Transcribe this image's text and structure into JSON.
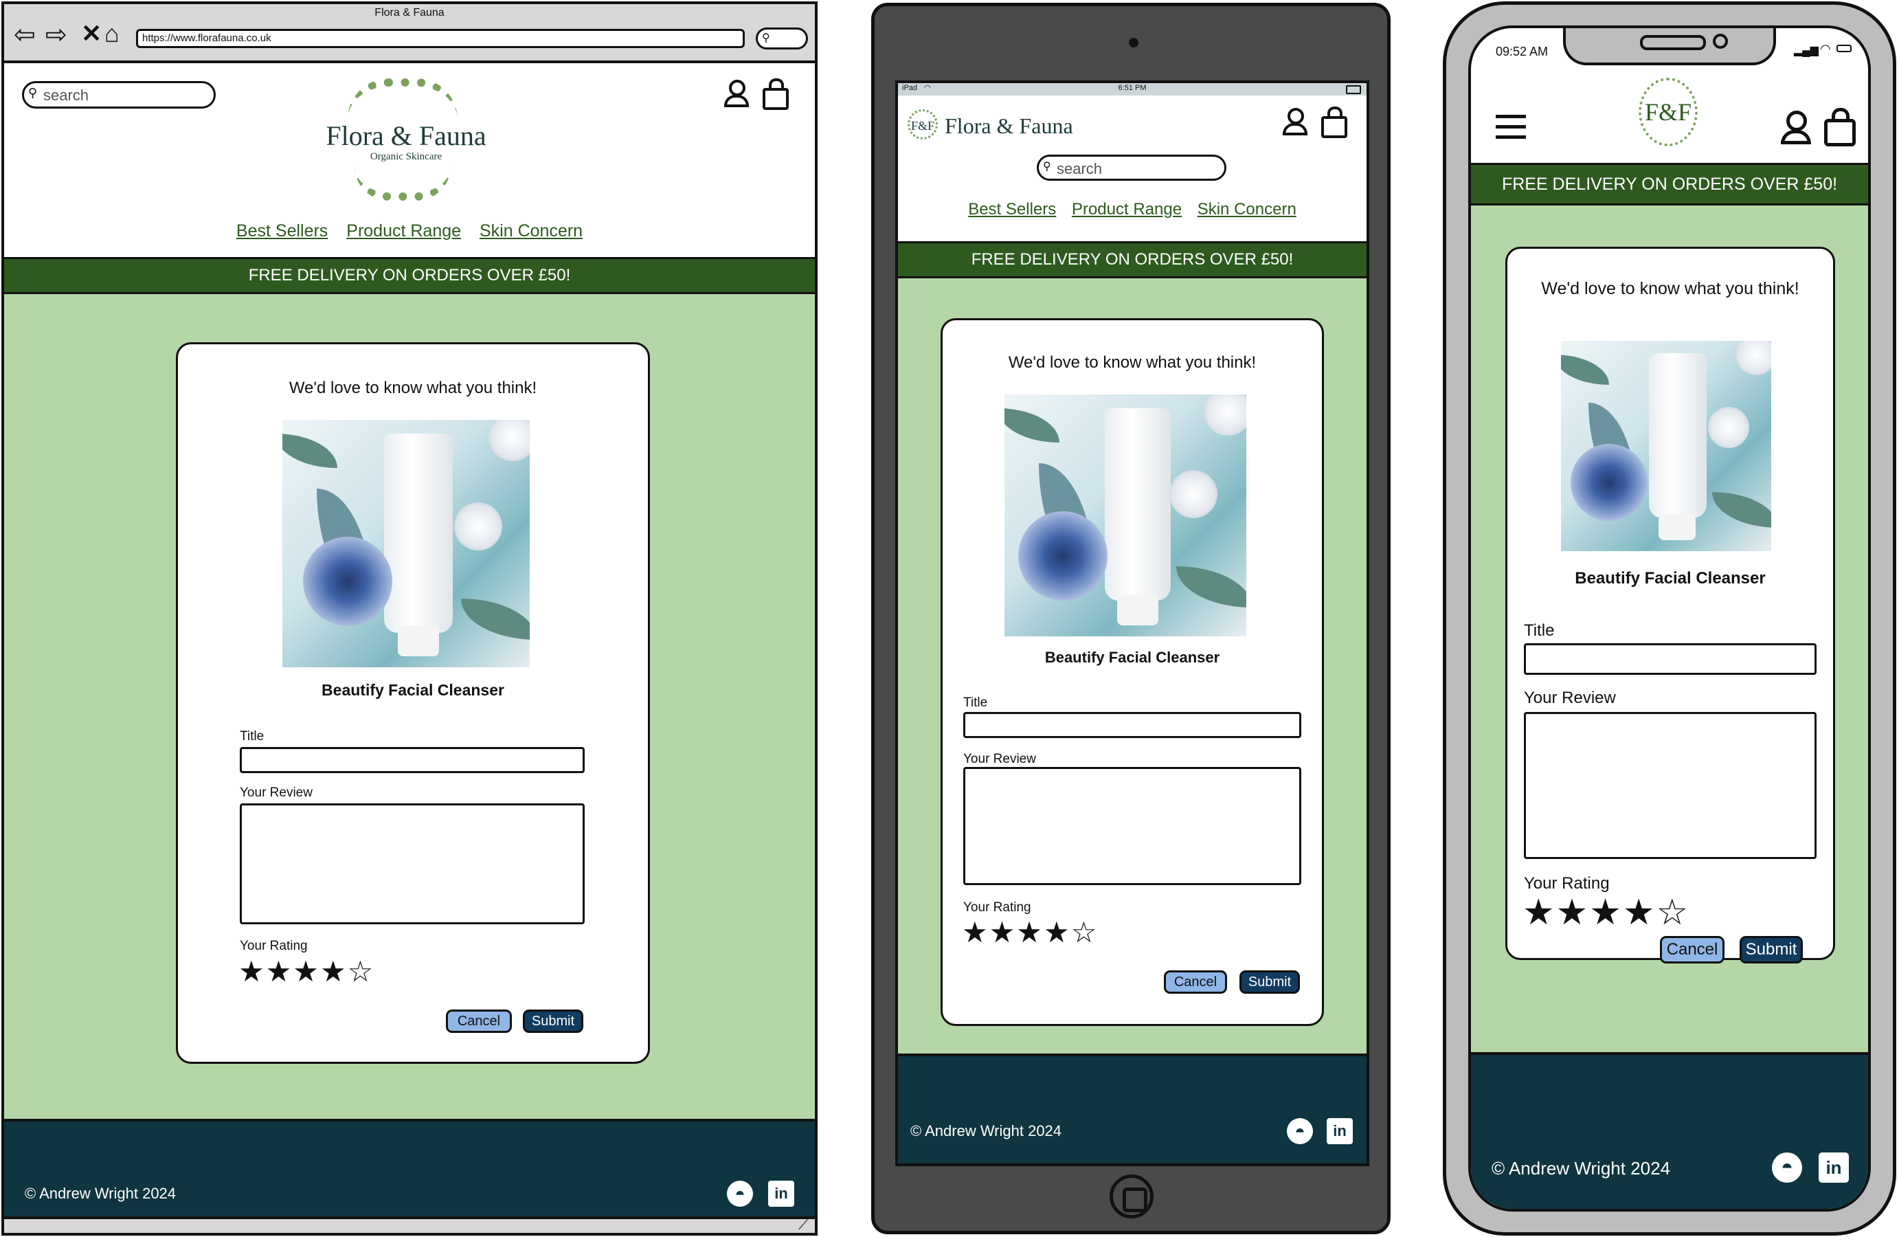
{
  "desktop": {
    "window_title": "Flora & Fauna",
    "url": "https://www.florafauna.co.uk",
    "search_placeholder": "search",
    "brand_name": "Flora & Fauna",
    "brand_tagline": "Organic Skincare",
    "nav": [
      "Best Sellers",
      "Product Range",
      "Skin Concern"
    ],
    "banner": "FREE DELIVERY ON ORDERS OVER £50!",
    "heading": "We'd love to know what you think!",
    "product_name": "Beautify Facial Cleanser",
    "title_label": "Title",
    "review_label": "Your Review",
    "rating_label": "Your Rating",
    "rating_stars": "★★★★☆",
    "rating_value": 4,
    "cancel": "Cancel",
    "submit": "Submit",
    "footer": "© Andrew Wright 2024"
  },
  "tablet": {
    "status_left": "iPad",
    "status_time": "6:51 PM",
    "brand_logo": "F&F",
    "brand_name": "Flora & Fauna",
    "search_placeholder": "search",
    "nav": [
      "Best Sellers",
      "Product Range",
      "Skin Concern"
    ],
    "banner": "FREE DELIVERY ON ORDERS OVER £50!",
    "heading": "We'd love to know what you think!",
    "product_name": "Beautify Facial Cleanser",
    "title_label": "Title",
    "review_label": "Your Review",
    "rating_label": "Your Rating",
    "rating_stars": "★★★★☆",
    "rating_value": 4,
    "cancel": "Cancel",
    "submit": "Submit",
    "footer": "© Andrew Wright 2024"
  },
  "phone": {
    "status_time": "09:52 AM",
    "brand_logo": "F&F",
    "banner": "FREE DELIVERY ON ORDERS OVER £50!",
    "heading": "We'd love to know what you think!",
    "product_name": "Beautify Facial Cleanser",
    "title_label": "Title",
    "review_label": "Your Review",
    "rating_label": "Your Rating",
    "rating_stars": "★★★★☆",
    "rating_value": 4,
    "cancel": "Cancel",
    "submit": "Submit",
    "footer": "© Andrew Wright 2024"
  },
  "icons": [
    "back-icon",
    "forward-icon",
    "close-icon",
    "home-icon",
    "search-icon",
    "account-icon",
    "bag-icon",
    "menu-icon",
    "github-icon",
    "linkedin-icon",
    "wifi-icon",
    "battery-icon",
    "signal-icon",
    "home-button-icon"
  ],
  "colors": {
    "background": "#b5d7a7",
    "banner": "#2e5a1f",
    "footer": "#0e3540",
    "nav_link": "#2e5a1f",
    "cancel_button": "#8fb6e6",
    "submit_button": "#123b60"
  }
}
